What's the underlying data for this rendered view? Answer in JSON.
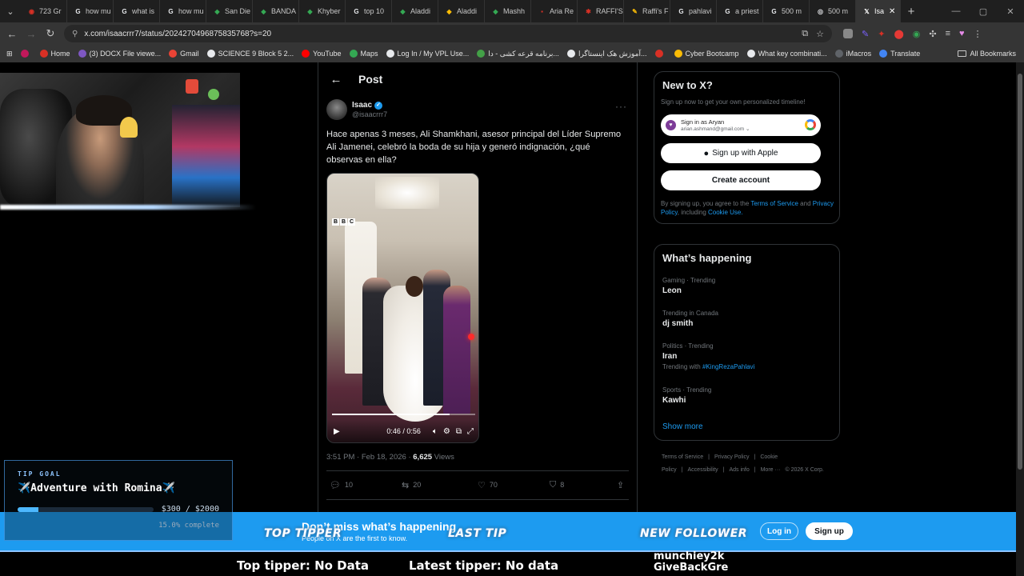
{
  "browser": {
    "tabs": [
      {
        "label": "723 Gr",
        "color": "#d93025",
        "glyph": "◉"
      },
      {
        "label": "how mu",
        "color": "#e8eaed",
        "glyph": "G"
      },
      {
        "label": "what is",
        "color": "#e8eaed",
        "glyph": "G"
      },
      {
        "label": "how mu",
        "color": "#e8eaed",
        "glyph": "G"
      },
      {
        "label": "San Die",
        "color": "#34a853",
        "glyph": "◆"
      },
      {
        "label": "BANDA",
        "color": "#34a853",
        "glyph": "◆"
      },
      {
        "label": "Khyber",
        "color": "#34a853",
        "glyph": "◆"
      },
      {
        "label": "top 10",
        "color": "#e8eaed",
        "glyph": "G"
      },
      {
        "label": "Aladdi",
        "color": "#34a853",
        "glyph": "◆"
      },
      {
        "label": "Aladdi",
        "color": "#fbbc05",
        "glyph": "◆"
      },
      {
        "label": "Mashh",
        "color": "#34a853",
        "glyph": "◆"
      },
      {
        "label": "Aria Re",
        "color": "#d93025",
        "glyph": "▪"
      },
      {
        "label": "RAFFI'S",
        "color": "#d93025",
        "glyph": "✱"
      },
      {
        "label": "Raffi's F",
        "color": "#fbbc05",
        "glyph": "✎"
      },
      {
        "label": "pahlavi",
        "color": "#e8eaed",
        "glyph": "G"
      },
      {
        "label": "a priest",
        "color": "#e8eaed",
        "glyph": "G"
      },
      {
        "label": "500 m",
        "color": "#e8eaed",
        "glyph": "G"
      },
      {
        "label": "500 m",
        "color": "#e8eaed",
        "glyph": "◎"
      }
    ],
    "active_tab": {
      "label": "Isa",
      "glyph": "𝕏"
    },
    "new_tab": "+",
    "url": "x.com/isaacrrr7/status/2024270496875835768?s=20",
    "bookmarks": [
      {
        "label": "",
        "color": "#c2185b"
      },
      {
        "label": "Home",
        "color": "#d93025"
      },
      {
        "label": "(3) DOCX File viewe...",
        "color": "#7e57c2"
      },
      {
        "label": "Gmail",
        "color": "#ea4335"
      },
      {
        "label": "SCIENCE 9 Block 5 2...",
        "color": "#e8eaed"
      },
      {
        "label": "YouTube",
        "color": "#ff0000"
      },
      {
        "label": "Maps",
        "color": "#34a853"
      },
      {
        "label": "Log In / My VPL Use...",
        "color": "#e8eaed"
      },
      {
        "label": "برنامه قرعه کشی - دا...",
        "color": "#43a047"
      },
      {
        "label": "آموزش هک اینستاگرا...",
        "color": "#e8eaed"
      },
      {
        "label": "",
        "color": "#d93025"
      },
      {
        "label": "Cyber Bootcamp",
        "color": "#fbbc05"
      },
      {
        "label": "What key combinati...",
        "color": "#e8eaed"
      },
      {
        "label": "iMacros",
        "color": "#5f6368"
      },
      {
        "label": "Translate",
        "color": "#4285f4"
      }
    ],
    "all_bookmarks": "All Bookmarks"
  },
  "post": {
    "header": "Post",
    "author_name": "Isaac",
    "author_handle": "@isaacrrr7",
    "text": "Hace apenas 3 meses, Ali Shamkhani, asesor principal del Líder Supremo Ali Jamenei, celebró la boda de su hija y generó indignación, ¿qué observas en ella?",
    "video": {
      "watermark": [
        "B",
        "B",
        "C"
      ],
      "time": "0:46 / 0:56",
      "progress": 0.82
    },
    "meta_time": "3:51 PM · Feb 18, 2026 · ",
    "views_count": "6,625",
    "views_label": " Views",
    "replies": "10",
    "reposts": "20",
    "likes": "70",
    "bookmarks": "8"
  },
  "sidebar": {
    "new_title": "New to X?",
    "new_sub": "Sign up now to get your own personalized timeline!",
    "google_name": "Sign in as Aryan",
    "google_email": "arian.ashmand@gmail.com",
    "apple_label": "Sign up with Apple",
    "create_label": "Create account",
    "terms_pre": "By signing up, you agree to the ",
    "terms_tos": "Terms of Service",
    "terms_and": " and ",
    "terms_privacy": "Privacy Policy",
    "terms_incl": ", including ",
    "terms_cookie": "Cookie Use.",
    "trends_title": "What’s happening",
    "trends": [
      {
        "category": "Gaming · Trending",
        "name": "Leon",
        "with": ""
      },
      {
        "category": "Trending in Canada",
        "name": "dj smith",
        "with": ""
      },
      {
        "category": "Politics · Trending",
        "name": "Iran",
        "with_pre": "Trending with ",
        "with": "#KingRezaPahlavi"
      },
      {
        "category": "Sports · Trending",
        "name": "Kawhi",
        "with": ""
      }
    ],
    "show_more": "Show more",
    "footer": [
      "Terms of Service",
      "|",
      "Privacy Policy",
      "|",
      "Cookie Policy",
      "|",
      "Accessibility",
      "|",
      "Ads info",
      "|",
      "More ···",
      "© 2026 X Corp."
    ]
  },
  "banner": {
    "title": "Don’t miss what’s happening",
    "sub": "People on X are the first to know.",
    "login": "Log in",
    "signup": "Sign up"
  },
  "overlay": {
    "top_tipper_label": "TOP TIPPER",
    "last_tip_label": "LAST TIP",
    "new_follower_label": "NEW FOLLOWER",
    "followers": [
      "munchiey2k",
      "GiveBackGre"
    ],
    "top_tipper_text": "Top tipper: No Data",
    "latest_tipper_text": "Latest tipper: No data",
    "tip_goal": {
      "label": "TIP GOAL",
      "title": "✈️Adventure with Romina✈️",
      "amount": "$300 / $2000",
      "complete": "15.0% complete",
      "fraction": 0.15
    }
  }
}
